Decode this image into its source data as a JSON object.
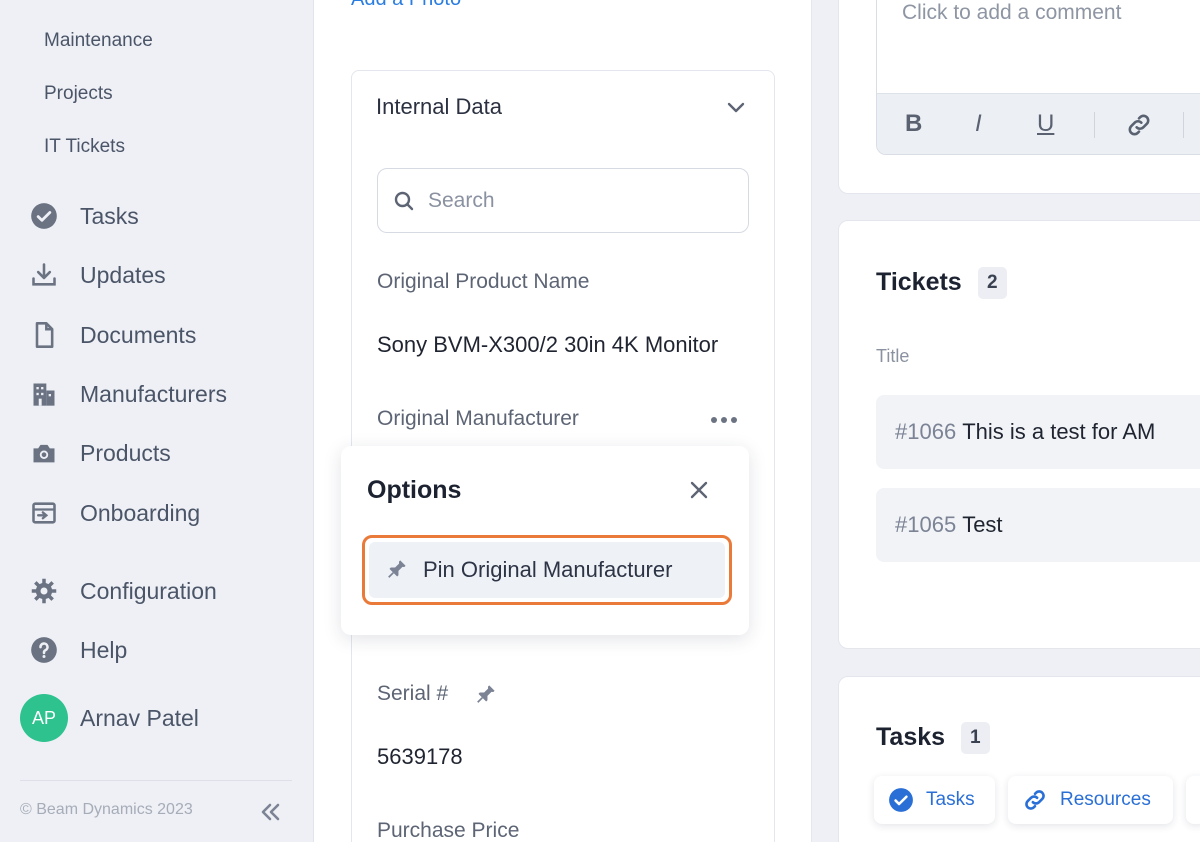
{
  "sidebar": {
    "sub_items": [
      {
        "label": "Maintenance"
      },
      {
        "label": "Projects"
      },
      {
        "label": "IT Tickets"
      }
    ],
    "nav_items": [
      {
        "label": "Tasks",
        "icon": "check-circle-icon"
      },
      {
        "label": "Updates",
        "icon": "download-icon"
      },
      {
        "label": "Documents",
        "icon": "document-icon"
      },
      {
        "label": "Manufacturers",
        "icon": "building-icon"
      },
      {
        "label": "Products",
        "icon": "camera-icon"
      },
      {
        "label": "Onboarding",
        "icon": "onboarding-icon"
      },
      {
        "label": "Configuration",
        "icon": "gear-icon"
      },
      {
        "label": "Help",
        "icon": "help-icon"
      }
    ],
    "user": {
      "initials": "AP",
      "name": "Arnav Patel",
      "avatar_color": "#2dc28e"
    },
    "copyright": "© Beam Dynamics 2023"
  },
  "asset": {
    "add_photo_label": "Add a Photo",
    "internal_data": {
      "title": "Internal Data",
      "search_placeholder": "Search",
      "fields": {
        "product_name_label": "Original Product Name",
        "product_name_value": "Sony BVM-X300/2 30in 4K Monitor",
        "manufacturer_label": "Original Manufacturer",
        "serial_label": "Serial #",
        "serial_value": "5639178",
        "price_label": "Purchase Price"
      }
    },
    "options_popover": {
      "title": "Options",
      "pin_label": "Pin Original Manufacturer",
      "highlight_color": "#ea7a3a"
    }
  },
  "comment": {
    "placeholder": "Click to add a comment",
    "toolbar": {
      "bold": "B",
      "italic": "I",
      "underline": "U"
    }
  },
  "tickets": {
    "title": "Tickets",
    "count": "2",
    "column_title": "Title",
    "rows": [
      {
        "id": "#1066",
        "name": "This is a test for AM"
      },
      {
        "id": "#1065",
        "name": "Test"
      }
    ]
  },
  "tasks_section": {
    "title": "Tasks",
    "count": "1"
  },
  "bottom_chips": [
    {
      "label": "Tasks",
      "icon": "check-circle-icon"
    },
    {
      "label": "Resources",
      "icon": "link-icon"
    }
  ],
  "colors": {
    "accent": "#2a7de1",
    "chip_text": "#2a6fd6"
  }
}
